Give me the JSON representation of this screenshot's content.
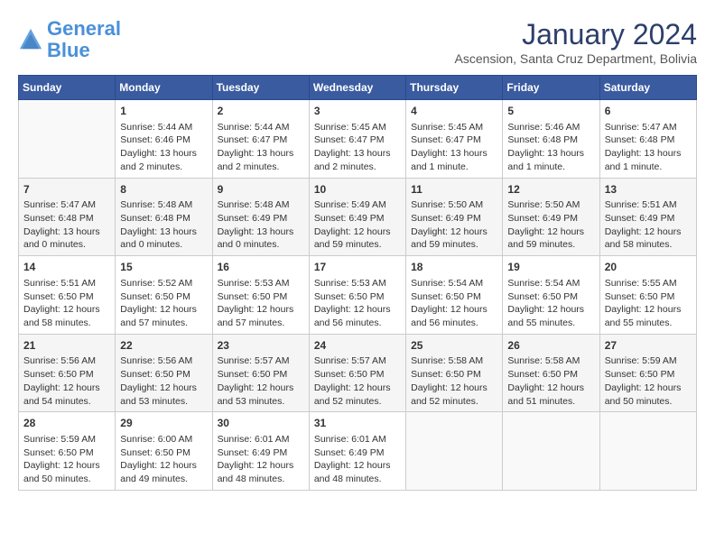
{
  "header": {
    "logo_line1": "General",
    "logo_line2": "Blue",
    "month": "January 2024",
    "location": "Ascension, Santa Cruz Department, Bolivia"
  },
  "days_of_week": [
    "Sunday",
    "Monday",
    "Tuesday",
    "Wednesday",
    "Thursday",
    "Friday",
    "Saturday"
  ],
  "weeks": [
    [
      {
        "num": "",
        "data": ""
      },
      {
        "num": "1",
        "data": "Sunrise: 5:44 AM\nSunset: 6:46 PM\nDaylight: 13 hours\nand 2 minutes."
      },
      {
        "num": "2",
        "data": "Sunrise: 5:44 AM\nSunset: 6:47 PM\nDaylight: 13 hours\nand 2 minutes."
      },
      {
        "num": "3",
        "data": "Sunrise: 5:45 AM\nSunset: 6:47 PM\nDaylight: 13 hours\nand 2 minutes."
      },
      {
        "num": "4",
        "data": "Sunrise: 5:45 AM\nSunset: 6:47 PM\nDaylight: 13 hours\nand 1 minute."
      },
      {
        "num": "5",
        "data": "Sunrise: 5:46 AM\nSunset: 6:48 PM\nDaylight: 13 hours\nand 1 minute."
      },
      {
        "num": "6",
        "data": "Sunrise: 5:47 AM\nSunset: 6:48 PM\nDaylight: 13 hours\nand 1 minute."
      }
    ],
    [
      {
        "num": "7",
        "data": "Sunrise: 5:47 AM\nSunset: 6:48 PM\nDaylight: 13 hours\nand 0 minutes."
      },
      {
        "num": "8",
        "data": "Sunrise: 5:48 AM\nSunset: 6:48 PM\nDaylight: 13 hours\nand 0 minutes."
      },
      {
        "num": "9",
        "data": "Sunrise: 5:48 AM\nSunset: 6:49 PM\nDaylight: 13 hours\nand 0 minutes."
      },
      {
        "num": "10",
        "data": "Sunrise: 5:49 AM\nSunset: 6:49 PM\nDaylight: 12 hours\nand 59 minutes."
      },
      {
        "num": "11",
        "data": "Sunrise: 5:50 AM\nSunset: 6:49 PM\nDaylight: 12 hours\nand 59 minutes."
      },
      {
        "num": "12",
        "data": "Sunrise: 5:50 AM\nSunset: 6:49 PM\nDaylight: 12 hours\nand 59 minutes."
      },
      {
        "num": "13",
        "data": "Sunrise: 5:51 AM\nSunset: 6:49 PM\nDaylight: 12 hours\nand 58 minutes."
      }
    ],
    [
      {
        "num": "14",
        "data": "Sunrise: 5:51 AM\nSunset: 6:50 PM\nDaylight: 12 hours\nand 58 minutes."
      },
      {
        "num": "15",
        "data": "Sunrise: 5:52 AM\nSunset: 6:50 PM\nDaylight: 12 hours\nand 57 minutes."
      },
      {
        "num": "16",
        "data": "Sunrise: 5:53 AM\nSunset: 6:50 PM\nDaylight: 12 hours\nand 57 minutes."
      },
      {
        "num": "17",
        "data": "Sunrise: 5:53 AM\nSunset: 6:50 PM\nDaylight: 12 hours\nand 56 minutes."
      },
      {
        "num": "18",
        "data": "Sunrise: 5:54 AM\nSunset: 6:50 PM\nDaylight: 12 hours\nand 56 minutes."
      },
      {
        "num": "19",
        "data": "Sunrise: 5:54 AM\nSunset: 6:50 PM\nDaylight: 12 hours\nand 55 minutes."
      },
      {
        "num": "20",
        "data": "Sunrise: 5:55 AM\nSunset: 6:50 PM\nDaylight: 12 hours\nand 55 minutes."
      }
    ],
    [
      {
        "num": "21",
        "data": "Sunrise: 5:56 AM\nSunset: 6:50 PM\nDaylight: 12 hours\nand 54 minutes."
      },
      {
        "num": "22",
        "data": "Sunrise: 5:56 AM\nSunset: 6:50 PM\nDaylight: 12 hours\nand 53 minutes."
      },
      {
        "num": "23",
        "data": "Sunrise: 5:57 AM\nSunset: 6:50 PM\nDaylight: 12 hours\nand 53 minutes."
      },
      {
        "num": "24",
        "data": "Sunrise: 5:57 AM\nSunset: 6:50 PM\nDaylight: 12 hours\nand 52 minutes."
      },
      {
        "num": "25",
        "data": "Sunrise: 5:58 AM\nSunset: 6:50 PM\nDaylight: 12 hours\nand 52 minutes."
      },
      {
        "num": "26",
        "data": "Sunrise: 5:58 AM\nSunset: 6:50 PM\nDaylight: 12 hours\nand 51 minutes."
      },
      {
        "num": "27",
        "data": "Sunrise: 5:59 AM\nSunset: 6:50 PM\nDaylight: 12 hours\nand 50 minutes."
      }
    ],
    [
      {
        "num": "28",
        "data": "Sunrise: 5:59 AM\nSunset: 6:50 PM\nDaylight: 12 hours\nand 50 minutes."
      },
      {
        "num": "29",
        "data": "Sunrise: 6:00 AM\nSunset: 6:50 PM\nDaylight: 12 hours\nand 49 minutes."
      },
      {
        "num": "30",
        "data": "Sunrise: 6:01 AM\nSunset: 6:49 PM\nDaylight: 12 hours\nand 48 minutes."
      },
      {
        "num": "31",
        "data": "Sunrise: 6:01 AM\nSunset: 6:49 PM\nDaylight: 12 hours\nand 48 minutes."
      },
      {
        "num": "",
        "data": ""
      },
      {
        "num": "",
        "data": ""
      },
      {
        "num": "",
        "data": ""
      }
    ]
  ]
}
